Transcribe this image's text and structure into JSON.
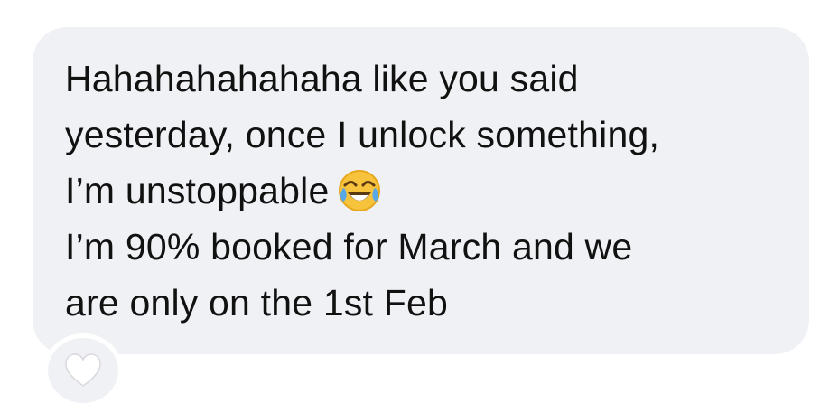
{
  "message": {
    "lines": [
      "Hahahahahahaha like you said",
      "yesterday, once I unlock something,",
      "I’m unstoppable",
      "I’m 90% booked for March and we",
      "are only on the 1st Feb"
    ],
    "emoji": "face-with-tears-of-joy",
    "reaction": "white-heart"
  },
  "colors": {
    "bubble": "#f0f1f4",
    "text": "#111111",
    "emoji_face": "#f7c33d",
    "heart": "#ffffff"
  }
}
